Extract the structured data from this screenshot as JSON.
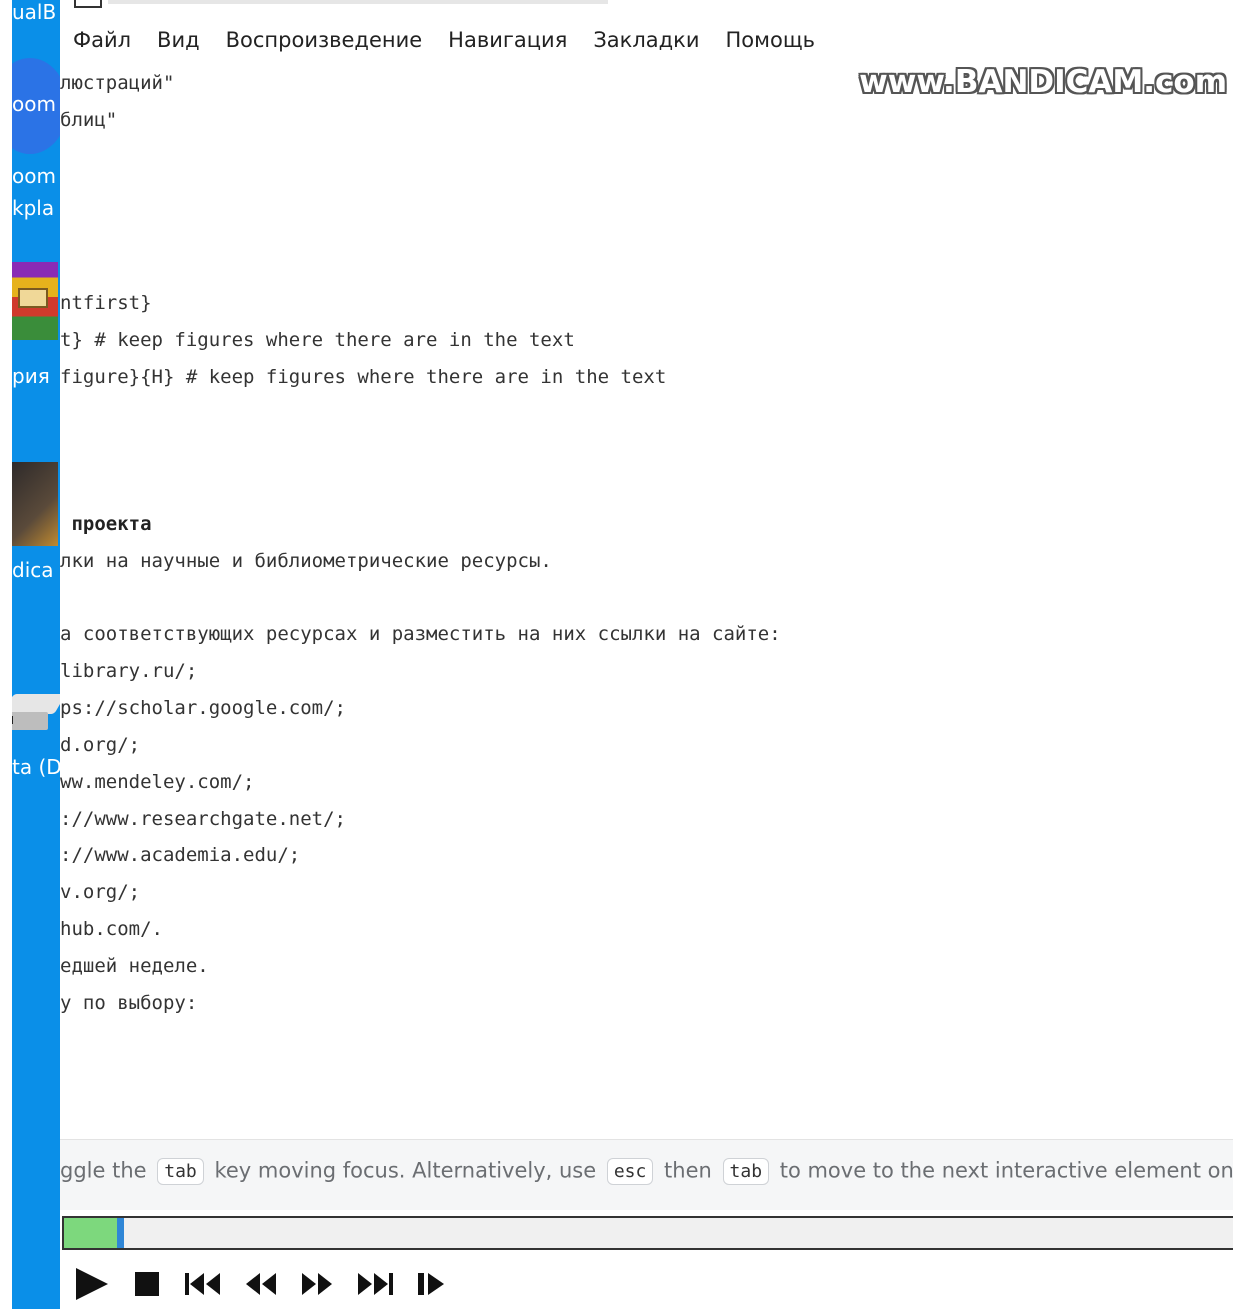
{
  "desktop": {
    "labels": [
      "ualB",
      "oom",
      "oom",
      "kpla",
      "рия",
      "dica",
      "ta (D"
    ]
  },
  "menu": {
    "items": [
      "Файл",
      "Вид",
      "Воспроизведение",
      "Навигация",
      "Закладки",
      "Помощь"
    ]
  },
  "watermark": {
    "text": "www.BANDICAM.com"
  },
  "content": {
    "lines": [
      "люстраций\"",
      "блиц\"",
      "ntfirst}",
      "t} # keep figures where there are in the text",
      "figure}{H} # keep figures where there are in the text",
      " проекта",
      "лки на научные и библиометрические ресурсы.",
      "а соответствующих ресурсах и разместить на них ссылки на сайте:",
      "library.ru/;",
      "ps://scholar.google.com/;",
      "d.org/;",
      "ww.mendeley.com/;",
      "://www.researchgate.net/;",
      "://www.academia.edu/;",
      "v.org/;",
      "hub.com/.",
      "едшей неделе.",
      "у по выбору:"
    ]
  },
  "help": {
    "part1": "ggle the",
    "key1": "tab",
    "part2": "key moving focus. Alternatively, use",
    "key2": "esc",
    "part3": "then",
    "key3": "tab",
    "part4": "to move to the next interactive element on th"
  },
  "player": {
    "progress_fraction": 0.045,
    "progress_color": "#7dd87d",
    "handle_color": "#2f86d6",
    "controls": [
      "play-icon",
      "stop-icon",
      "skip-to-start-icon",
      "rewind-icon",
      "fast-forward-icon",
      "skip-to-end-icon",
      "step-forward-icon"
    ]
  }
}
